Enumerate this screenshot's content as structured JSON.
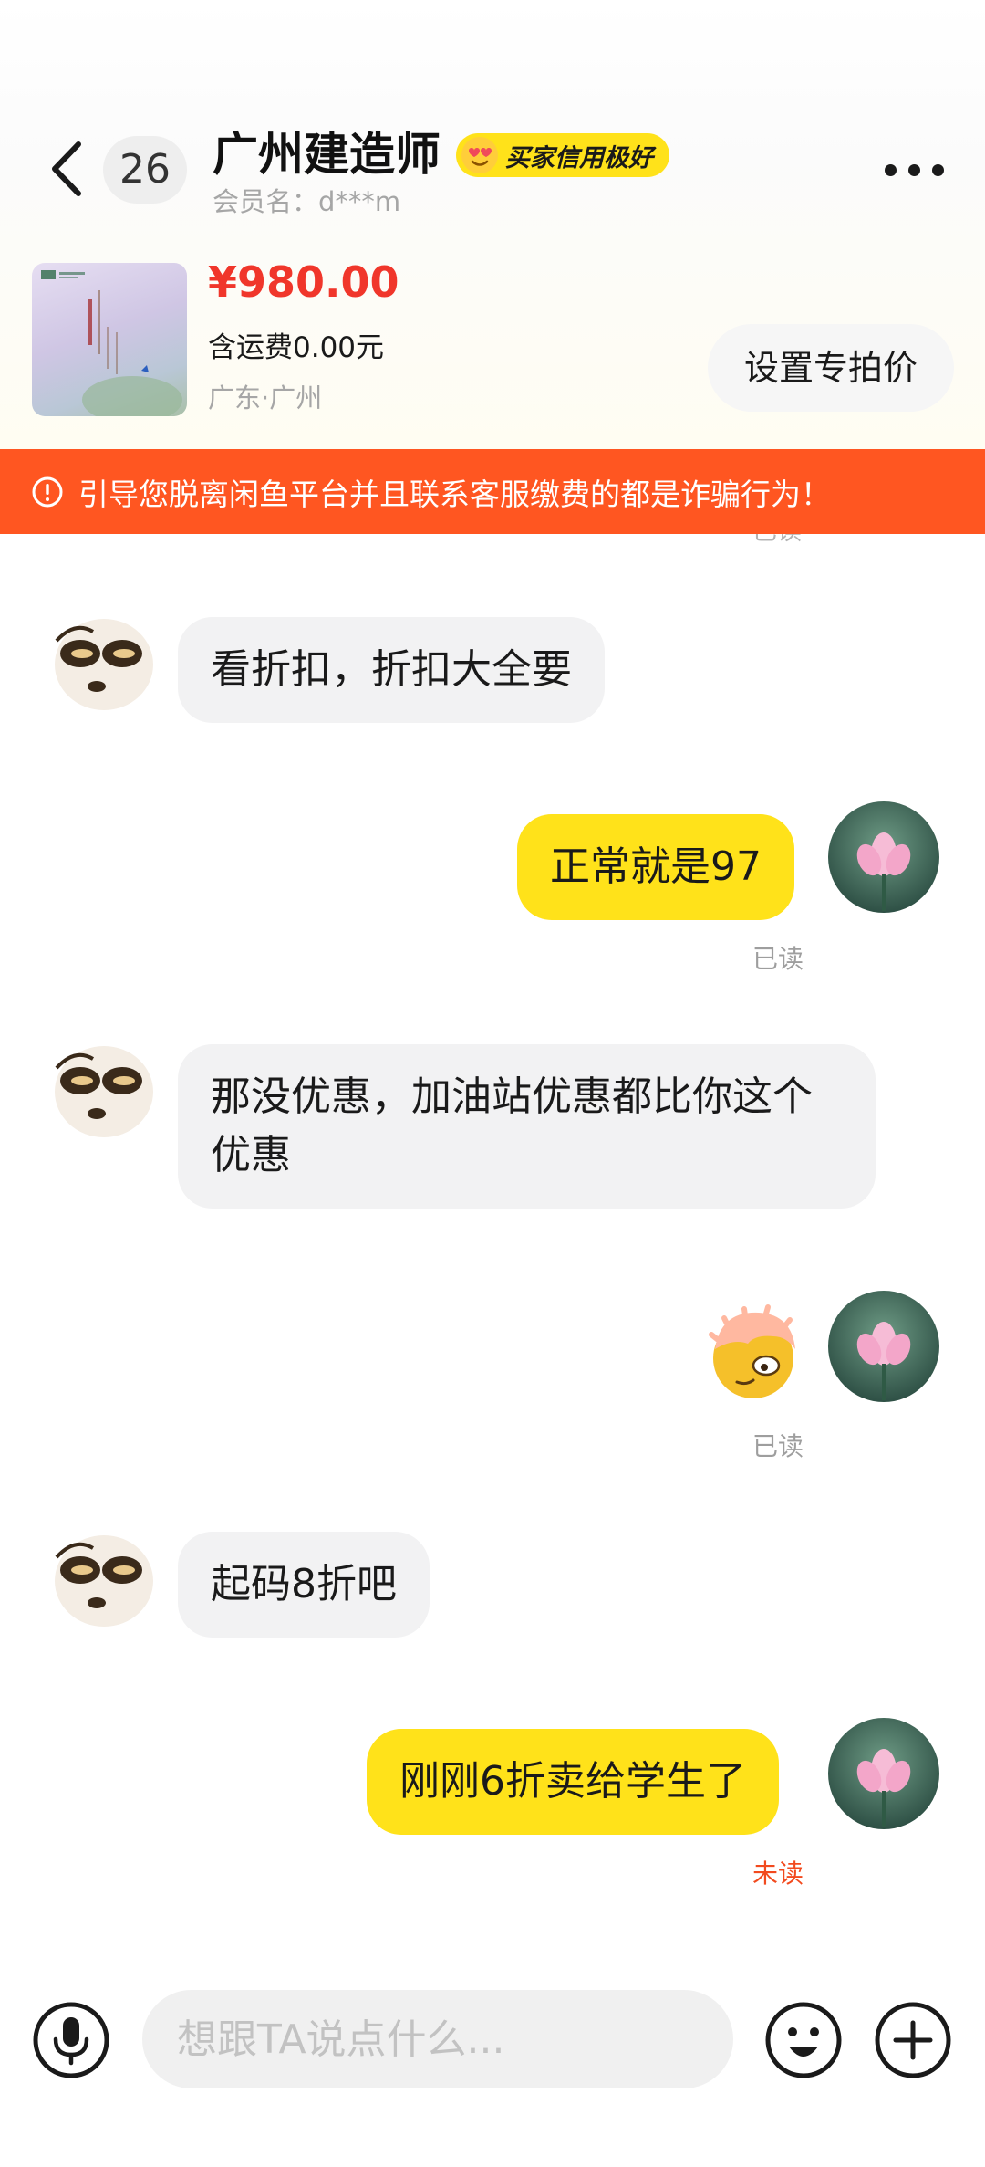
{
  "header": {
    "unread_count": "26",
    "title": "广州建造师",
    "credit_badge": "买家信用极好",
    "member_name": "会员名：d***m"
  },
  "product": {
    "price": "¥980.00",
    "shipping": "含运费0.00元",
    "location": "广东·广州",
    "special_price_button": "设置专拍价"
  },
  "warning": {
    "text": "引导您脱离闲鱼平台并且联系客服缴费的都是诈骗行为！"
  },
  "messages": [
    {
      "from": "other",
      "text": "看折扣，折扣大全要"
    },
    {
      "from": "me",
      "text": "正常就是97",
      "status": "已读"
    },
    {
      "from": "other",
      "text": "那没优惠，加油站优惠都比你这个优惠"
    },
    {
      "from": "me",
      "sticker": "sticker-emoji",
      "status": "已读"
    },
    {
      "from": "other",
      "text": "起码8折吧"
    },
    {
      "from": "me",
      "text": "刚刚6折卖给学生了",
      "status": "未读"
    }
  ],
  "peek_status": "已读",
  "input": {
    "placeholder": "想跟TA说点什么..."
  },
  "colors": {
    "accent_yellow": "#ffe21a",
    "warning_orange": "#ff5621",
    "price_red": "#f0362b",
    "unread_red": "#f24a1e"
  },
  "icons": [
    "back-icon",
    "more-icon",
    "alert-icon",
    "microphone-icon",
    "emoji-icon",
    "plus-icon"
  ]
}
